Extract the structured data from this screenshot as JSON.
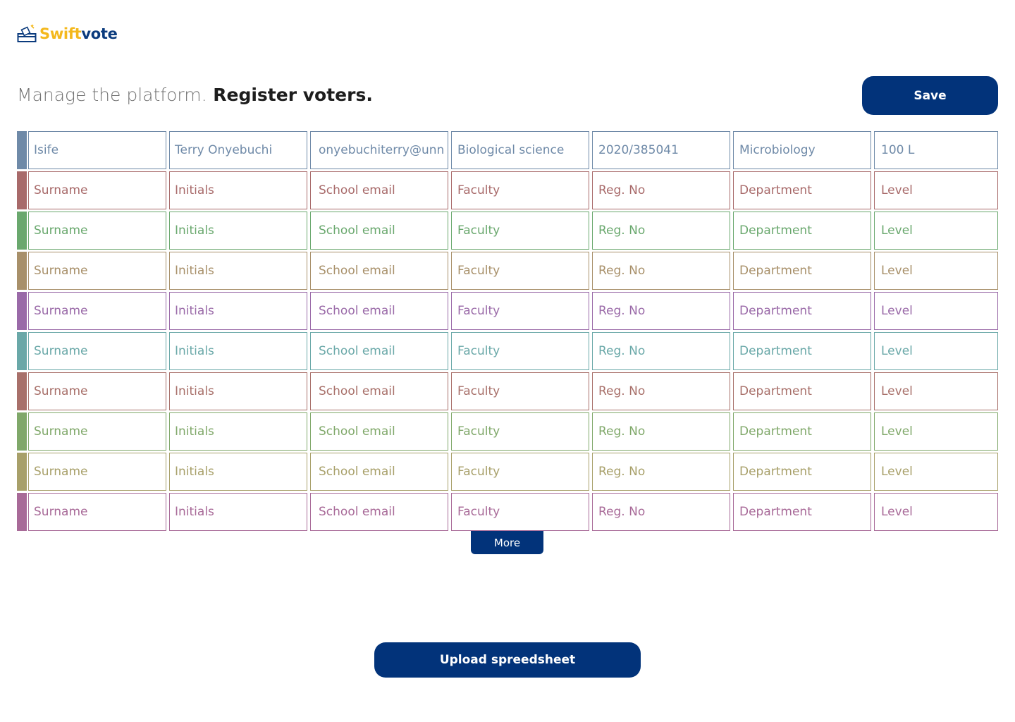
{
  "brand": {
    "name_part1": "Swift",
    "name_part2": "vote",
    "logo_icon": "ballot-box-icon",
    "colors": {
      "primary": "#02337a",
      "accent": "#f4b81c"
    }
  },
  "header": {
    "title_light": "Manage the platform.",
    "title_strong": "Register voters.",
    "save_label": "Save"
  },
  "table": {
    "rows": [
      {
        "color": "#6f8aa8",
        "cells": [
          "Isife",
          "Terry Onyebuchi",
          "onyebuchiterry@unn",
          "Biological science",
          "2020/385041",
          "Microbiology",
          "100 L"
        ]
      },
      {
        "color": "#a86a6a",
        "cells": [
          "Surname",
          "Initials",
          "School email",
          "Faculty",
          "Reg. No",
          "Department",
          "Level"
        ]
      },
      {
        "color": "#6aa86e",
        "cells": [
          "Surname",
          "Initials",
          "School email",
          "Faculty",
          "Reg. No",
          "Department",
          "Level"
        ]
      },
      {
        "color": "#a8906a",
        "cells": [
          "Surname",
          "Initials",
          "School email",
          "Faculty",
          "Reg. No",
          "Department",
          "Level"
        ]
      },
      {
        "color": "#9a6aa8",
        "cells": [
          "Surname",
          "Initials",
          "School email",
          "Faculty",
          "Reg. No",
          "Department",
          "Level"
        ]
      },
      {
        "color": "#6aa8a8",
        "cells": [
          "Surname",
          "Initials",
          "School email",
          "Faculty",
          "Reg. No",
          "Department",
          "Level"
        ]
      },
      {
        "color": "#a8706a",
        "cells": [
          "Surname",
          "Initials",
          "School email",
          "Faculty",
          "Reg. No",
          "Department",
          "Level"
        ]
      },
      {
        "color": "#80a86a",
        "cells": [
          "Surname",
          "Initials",
          "School email",
          "Faculty",
          "Reg. No",
          "Department",
          "Level"
        ]
      },
      {
        "color": "#a8a06a",
        "cells": [
          "Surname",
          "Initials",
          "School email",
          "Faculty",
          "Reg. No",
          "Department",
          "Level"
        ]
      },
      {
        "color": "#a86a98",
        "cells": [
          "Surname",
          "Initials",
          "School email",
          "Faculty",
          "Reg. No",
          "Department",
          "Level"
        ]
      }
    ]
  },
  "actions": {
    "more_label": "More",
    "upload_label": "Upload spreedsheet"
  }
}
